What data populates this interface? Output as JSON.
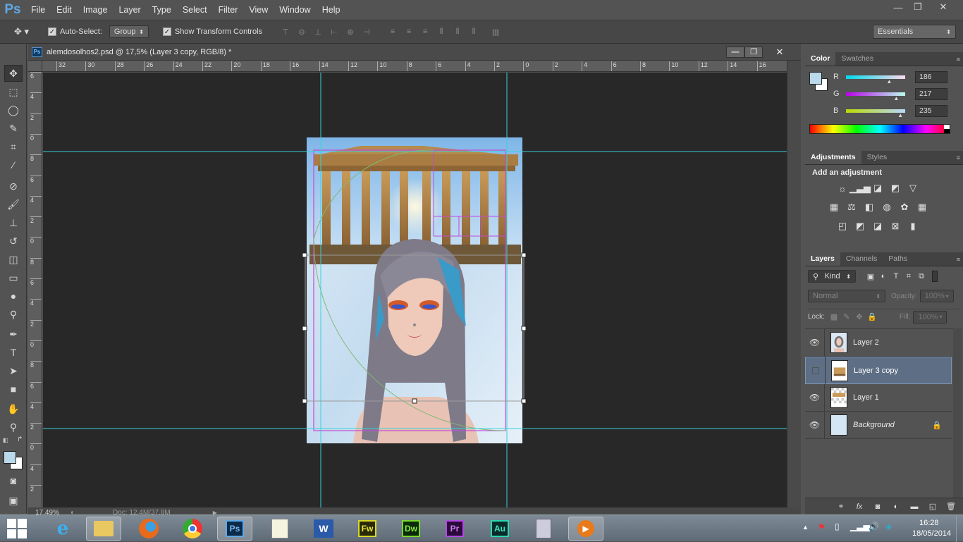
{
  "app": {
    "logo": "Ps"
  },
  "menu": [
    "File",
    "Edit",
    "Image",
    "Layer",
    "Type",
    "Select",
    "Filter",
    "View",
    "Window",
    "Help"
  ],
  "window_controls": {
    "minimize": "—",
    "restore": "❐",
    "close": "✕"
  },
  "options": {
    "auto_select_label": "Auto-Select:",
    "auto_select_value": "Group",
    "transform_label": "Show Transform Controls",
    "workspace": "Essentials"
  },
  "document": {
    "title": "alemdosolhos2.psd @ 17,5% (Layer 3 copy, RGB/8) *",
    "zoom": "17,49%",
    "doc_info": "Doc: 12,4M/37,8M",
    "ruler_top": [
      "32",
      "30",
      "28",
      "26",
      "24",
      "22",
      "20",
      "18",
      "16",
      "14",
      "12",
      "10",
      "8",
      "6",
      "4",
      "2",
      "0",
      "2",
      "4",
      "6",
      "8",
      "10",
      "12",
      "14",
      "16"
    ],
    "ruler_left": [
      "6",
      "4",
      "2",
      "0",
      "8",
      "6",
      "4",
      "2",
      "0",
      "8",
      "6",
      "4",
      "2",
      "0",
      "8",
      "6",
      "4",
      "2",
      "0",
      "4",
      "2"
    ]
  },
  "color_panel": {
    "tabs": [
      "Color",
      "Swatches"
    ],
    "r_label": "R",
    "g_label": "G",
    "b_label": "B",
    "r": "186",
    "g": "217",
    "b": "235",
    "r_fraction": 0.73,
    "g_fraction": 0.85,
    "b_fraction": 0.92,
    "fg_color": "#bad9eb",
    "bg_color": "#ffffff"
  },
  "adjustments_panel": {
    "tabs": [
      "Adjustments",
      "Styles"
    ],
    "heading": "Add an adjustment",
    "icons_row1": [
      "brightness-icon",
      "levels-icon",
      "curves-icon",
      "exposure-icon",
      "vibrance-icon"
    ],
    "icons_row2": [
      "hue-sat-icon",
      "color-balance-icon",
      "black-white-icon",
      "photo-filter-icon",
      "channel-mixer-icon",
      "color-lookup-icon"
    ],
    "icons_row3": [
      "invert-icon",
      "posterize-icon",
      "threshold-icon",
      "selective-color-icon",
      "gradient-map-icon"
    ]
  },
  "layers_panel": {
    "tabs": [
      "Layers",
      "Channels",
      "Paths"
    ],
    "filter_kind": "Kind",
    "blend_mode": "Normal",
    "opacity_label": "Opacity:",
    "opacity_value": "100%",
    "lock_label": "Lock:",
    "fill_label": "Fill:",
    "fill_value": "100%",
    "layers": [
      {
        "name": "Layer 2",
        "visible": true,
        "selected": false,
        "italic": false
      },
      {
        "name": "Layer 3 copy",
        "visible": false,
        "selected": true,
        "italic": false
      },
      {
        "name": "Layer 1",
        "visible": true,
        "selected": false,
        "italic": false
      },
      {
        "name": "Background",
        "visible": true,
        "selected": false,
        "italic": true,
        "locked": true
      }
    ]
  },
  "taskbar": {
    "apps": [
      "ie-icon",
      "explorer-icon",
      "firefox-icon",
      "chrome-icon",
      "photoshop-icon",
      "notepad-icon",
      "word-icon",
      "fireworks-icon",
      "dreamweaver-icon",
      "premiere-icon",
      "audition-icon",
      "calculator-icon",
      "media-player-icon"
    ],
    "labels": {
      "ps": "Ps",
      "fw": "Fw",
      "dw": "Dw",
      "pr": "Pr",
      "au": "Au",
      "word": "W"
    },
    "time": "16:28",
    "date": "18/05/2014"
  }
}
